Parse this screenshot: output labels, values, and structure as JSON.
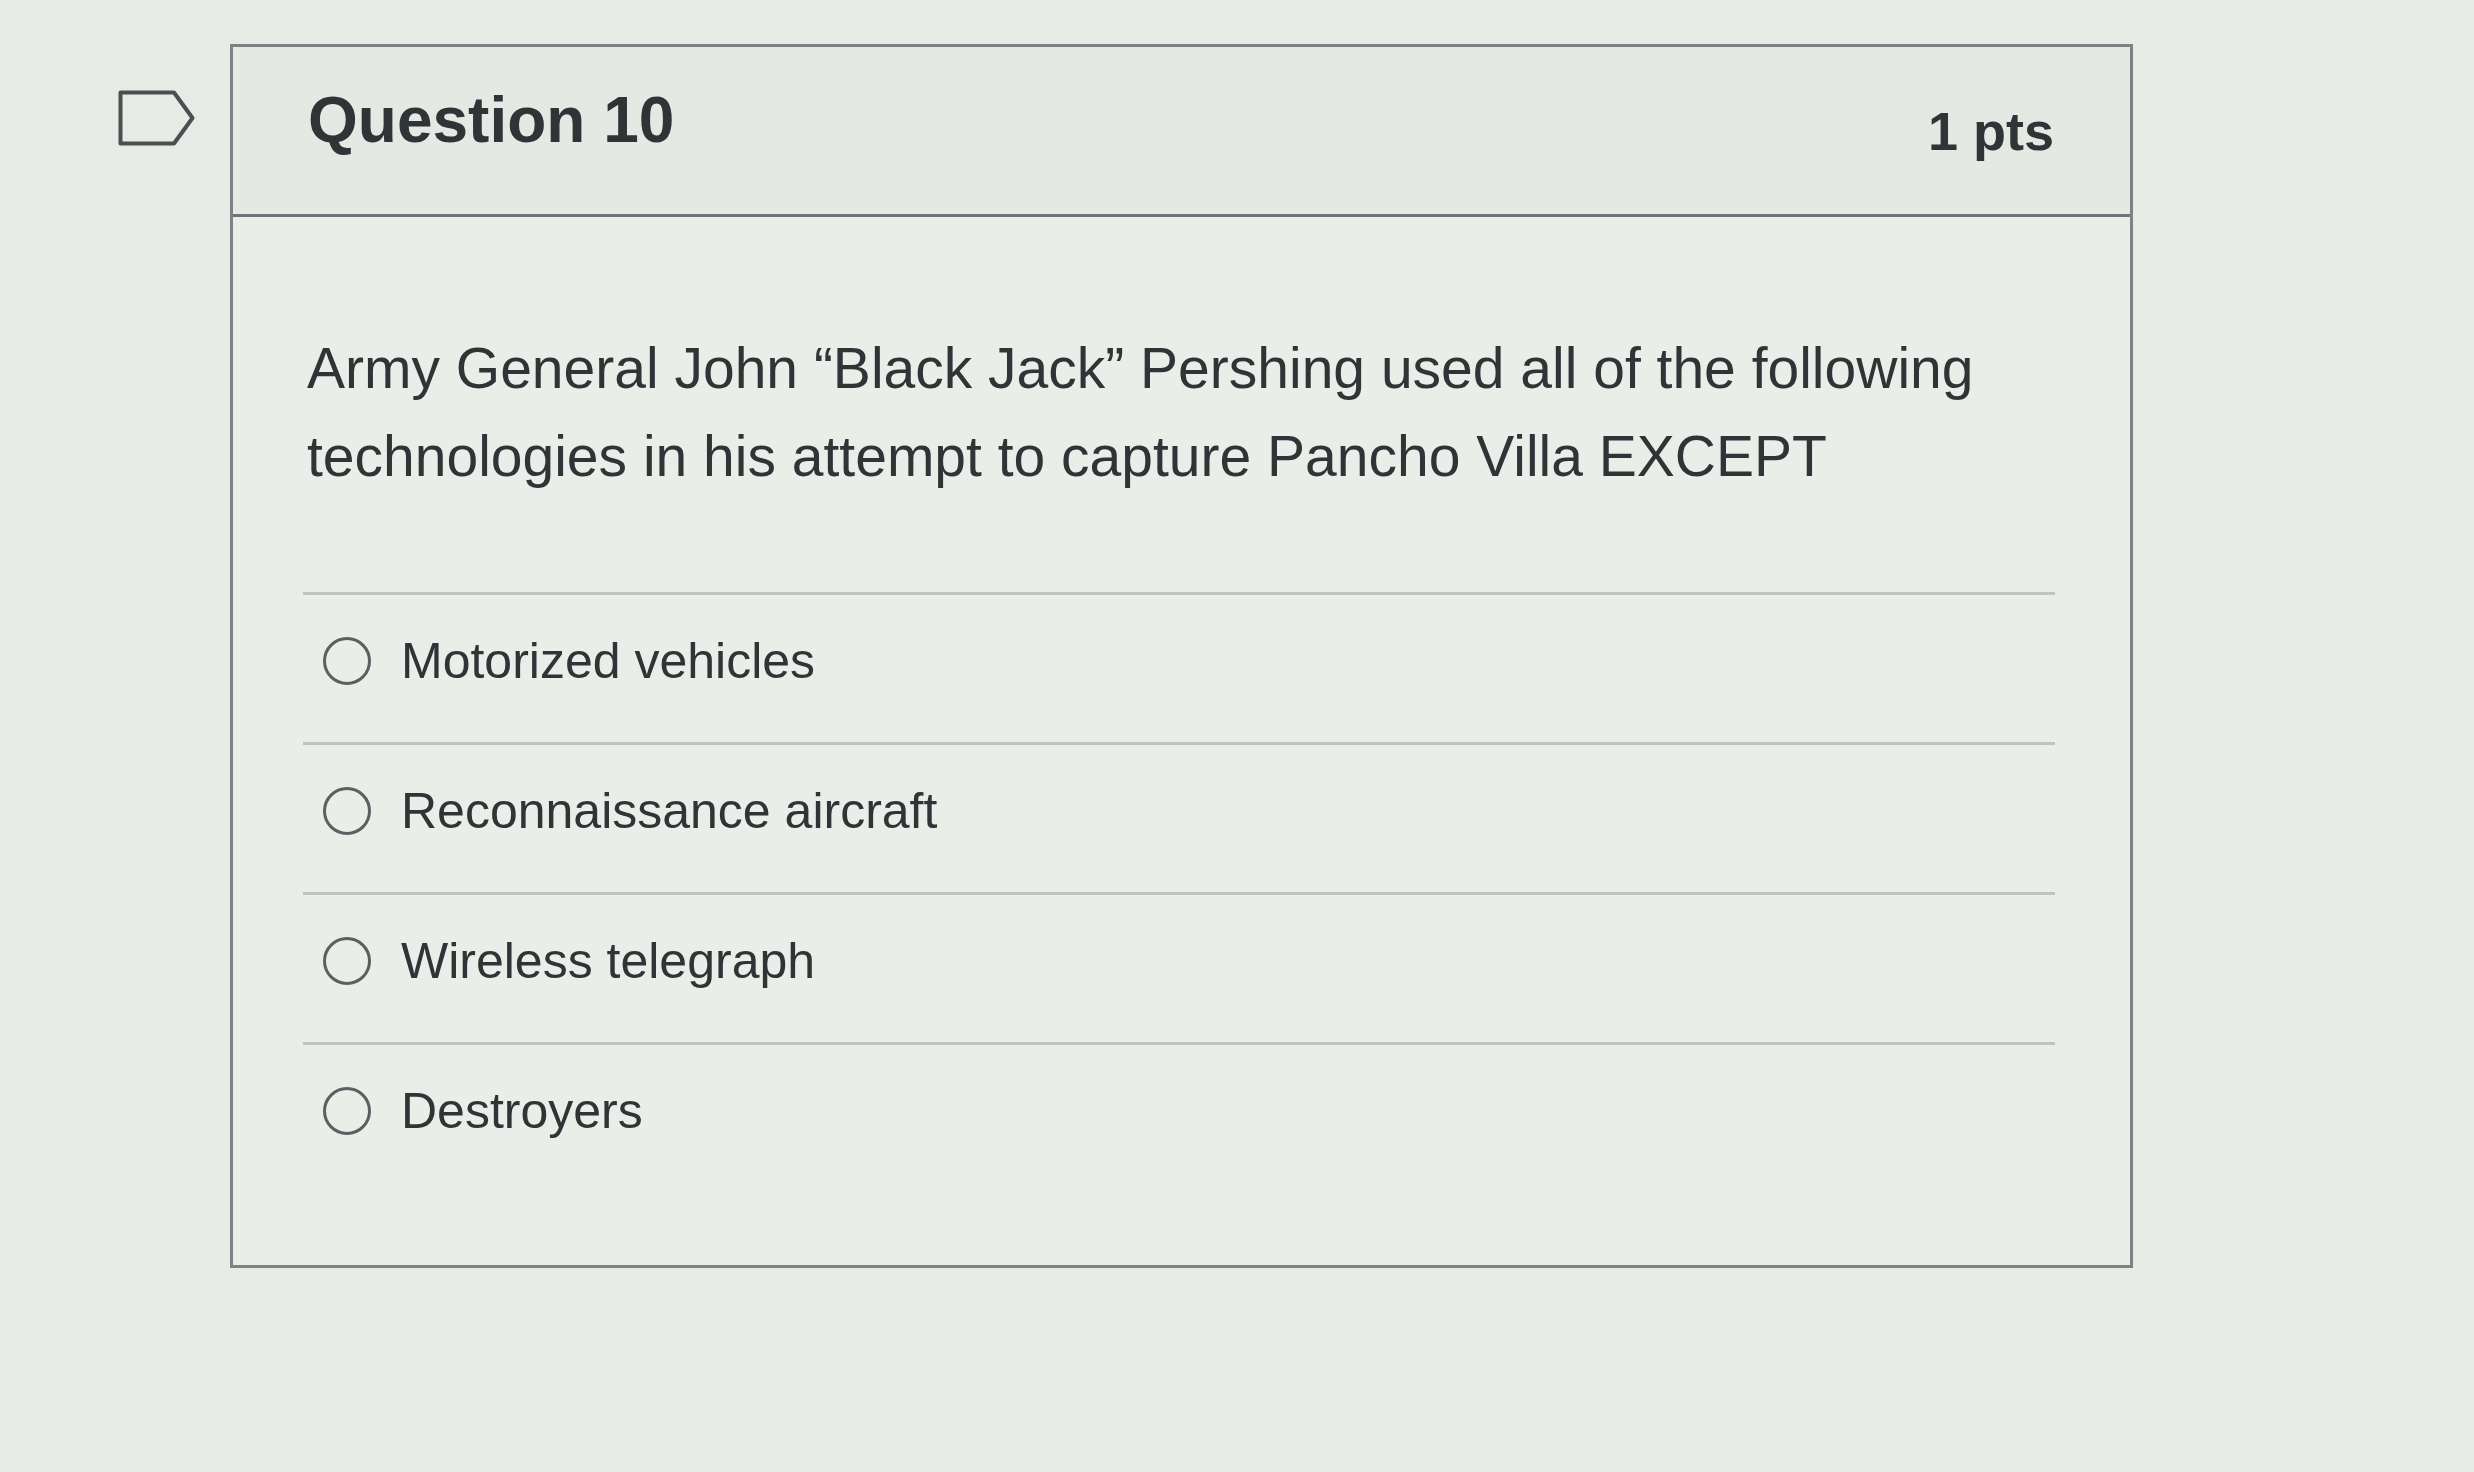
{
  "question": {
    "flagged": false,
    "title": "Question 10",
    "points": "1 pts",
    "text": "Army General John “Black Jack” Pershing used all of the following technologies in his attempt to capture Pancho Villa EXCEPT",
    "answers": [
      {
        "label": "Motorized vehicles",
        "selected": false
      },
      {
        "label": "Reconnaissance aircraft",
        "selected": false
      },
      {
        "label": "Wireless telegraph",
        "selected": false
      },
      {
        "label": "Destroyers",
        "selected": false
      }
    ]
  }
}
